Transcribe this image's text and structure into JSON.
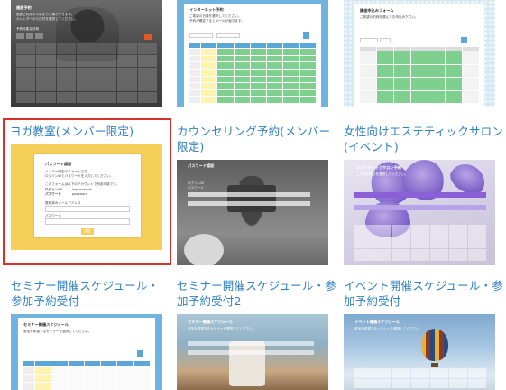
{
  "cards": [
    {
      "id": "card-1",
      "caption": "",
      "thumb": {
        "title": "施設予約",
        "lines": [
          "施設ご利用の予約を行う事ができます。",
          "カレンダーから日付を選択してください。"
        ],
        "legend": "予約可能な日時"
      }
    },
    {
      "id": "card-2",
      "caption": "",
      "thumb": {
        "title": "インターネット予約",
        "lines": [
          "ご希望の日時を選択してください。",
          "予約が確定するとメールが届きます。"
        ]
      }
    },
    {
      "id": "card-3",
      "caption": "",
      "thumb": {
        "title": "講座申込みフォーム",
        "lines": [
          "ご希望の日程を選んでお申込み下さい。"
        ]
      }
    },
    {
      "id": "card-4",
      "caption": "ヨガ教室(メンバー限定)",
      "selected": true,
      "thumb": {
        "title": "パスワード認証",
        "lines": [
          "メンバー限定のフォームです。",
          "ログインIDとパスワードを入力してください。",
          "このフォームは以下のアカウントで利用可能です。"
        ],
        "login_id_label": "ログインID",
        "login_id_value": "loginsample",
        "password_label": "パスワード",
        "password_value": "password",
        "field_label_1": "登録済みメールアドレス",
        "field_label_2": "パスワード",
        "button_label": "認証"
      }
    },
    {
      "id": "card-5",
      "caption": "カウンセリング予約(メンバー限定)",
      "thumb": {
        "title": "パスワード認証",
        "lines": [
          "ログインID",
          "パスワード"
        ]
      }
    },
    {
      "id": "card-6",
      "caption": "女性向けエステティックサロン(イベント)",
      "thumb": {
        "title": "エステティックサロン予約",
        "lines": [
          "ご予約希望日を選択してください。"
        ]
      }
    },
    {
      "id": "card-7",
      "caption": "セミナー開催スケジュール・参加予約受付",
      "thumb": {
        "title": "セミナー開催スケジュール",
        "lines": [
          "参加を希望するセミナーを選択してください。"
        ]
      }
    },
    {
      "id": "card-8",
      "caption": "セミナー開催スケジュール・参加予約受付2",
      "thumb": {
        "title": "セミナー開催スケジュール",
        "lines": [
          "参加を希望するセミナーを選択してください。"
        ]
      }
    },
    {
      "id": "card-9",
      "caption": "イベント開催スケジュール・参加予約受付",
      "thumb": {
        "title": "イベント開催スケジュール",
        "lines": [
          "参加を希望するイベントを選択してください。"
        ]
      }
    }
  ],
  "colors": {
    "caption_link": "#2f7fc1",
    "selected_outline": "#d7312c",
    "yellow_bg": "#f6cf5a",
    "blue_frame": "#6fb3de",
    "accent_button": "#f6cf5a"
  }
}
